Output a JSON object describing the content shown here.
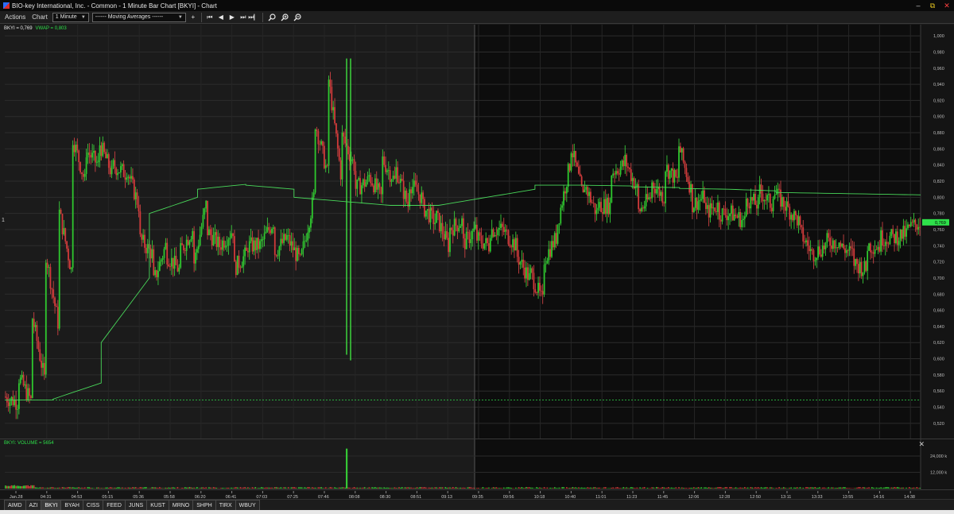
{
  "window": {
    "title": "BIO-key International, Inc. - Common - 1 Minute Bar Chart [BKYI] - Chart",
    "controls": [
      "–",
      "⧉",
      "✕"
    ]
  },
  "toolbar": {
    "actions_label": "Actions",
    "chart_label": "Chart",
    "interval_value": "1 Minute",
    "indicator_value": "------ Moving Averages ------",
    "add_label": "+",
    "nav_labels": [
      "⏮",
      "◀",
      "▶",
      "⏭",
      "⏭▏"
    ]
  },
  "price_pane": {
    "symbol_legend": "BKYI = 0,769",
    "vwap_legend": "VWAP = 0,803",
    "left_marker": "1"
  },
  "volume_pane": {
    "legend": "BKYI: VOLUME = 5654",
    "close_icon": "✕"
  },
  "tabs": [
    {
      "label": "AIMD",
      "active": false
    },
    {
      "label": "AZI",
      "active": false
    },
    {
      "label": "BKYI",
      "active": true
    },
    {
      "label": "BYAH",
      "active": false
    },
    {
      "label": "CISS",
      "active": false
    },
    {
      "label": "FEED",
      "active": false
    },
    {
      "label": "JUNS",
      "active": false
    },
    {
      "label": "KUST",
      "active": false
    },
    {
      "label": "MRNO",
      "active": false
    },
    {
      "label": "SHPH",
      "active": false
    },
    {
      "label": "TIRX",
      "active": false
    },
    {
      "label": "WBUY",
      "active": false
    }
  ],
  "chart_data": {
    "type": "candlestick",
    "symbol": "BKYI",
    "interval": "1 Minute",
    "last_price": "0,769",
    "vwap_value": "0,803",
    "volume_value": "5654",
    "y_ticks": [
      "1,000",
      "0,980",
      "0,960",
      "0,940",
      "0,920",
      "0,900",
      "0,880",
      "0,860",
      "0,840",
      "0,820",
      "0,800",
      "0,780",
      "0,760",
      "0,740",
      "0,720",
      "0,700",
      "0,680",
      "0,660",
      "0,640",
      "0,620",
      "0,600",
      "0,580",
      "0,560",
      "0,540",
      "0,520"
    ],
    "y_values": [
      1.0,
      0.98,
      0.96,
      0.94,
      0.92,
      0.9,
      0.88,
      0.86,
      0.84,
      0.82,
      0.8,
      0.78,
      0.76,
      0.74,
      0.72,
      0.7,
      0.68,
      0.66,
      0.64,
      0.62,
      0.6,
      0.58,
      0.56,
      0.54,
      0.52
    ],
    "ylim": [
      0.51,
      1.008
    ],
    "volume_ticks": [
      "24,000 k",
      "12,000 k"
    ],
    "volume_tick_values": [
      24000,
      12000
    ],
    "volume_max_k": 34000,
    "x_labels": [
      "Jan.28",
      "04:31",
      "04:53",
      "05:15",
      "05:36",
      "05:58",
      "06:20",
      "06:41",
      "07:03",
      "07:25",
      "07:46",
      "08:08",
      "08:30",
      "08:51",
      "09:13",
      "09:35",
      "09:56",
      "10:18",
      "10:40",
      "11:01",
      "11:23",
      "11:45",
      "12:06",
      "12:28",
      "12:50",
      "13:11",
      "13:33",
      "13:55",
      "14:16",
      "14:38"
    ],
    "session_split_label": "09:35",
    "prior_close": 0.549,
    "price_path": [
      [
        0.553,
        0.546
      ],
      [
        0.58,
        0.548
      ],
      [
        0.66,
        0.575
      ],
      [
        0.74,
        0.645
      ],
      [
        0.79,
        0.71
      ],
      [
        0.88,
        0.82
      ],
      [
        0.86,
        0.84
      ],
      [
        0.87,
        0.83
      ],
      [
        0.84,
        0.83
      ],
      [
        0.84,
        0.79
      ],
      [
        0.75,
        0.73
      ],
      [
        0.69,
        0.74
      ],
      [
        0.73,
        0.71
      ],
      [
        0.73,
        0.76
      ],
      [
        0.71,
        0.79
      ],
      [
        0.76,
        0.74
      ],
      [
        0.74,
        0.76
      ],
      [
        0.71,
        0.73
      ],
      [
        0.74,
        0.74
      ],
      [
        0.74,
        0.77
      ],
      [
        0.73,
        0.75
      ],
      [
        0.75,
        0.72
      ],
      [
        0.72,
        0.8
      ],
      [
        0.9,
        0.83
      ],
      [
        0.96,
        0.83
      ],
      [
        0.88,
        0.84
      ],
      [
        0.81,
        0.82
      ],
      [
        0.83,
        0.8
      ],
      [
        0.85,
        0.82
      ],
      [
        0.84,
        0.79
      ],
      [
        0.82,
        0.8
      ],
      [
        0.79,
        0.77
      ],
      [
        0.78,
        0.74
      ],
      [
        0.76,
        0.77
      ],
      [
        0.74,
        0.76
      ],
      [
        0.75,
        0.74
      ],
      [
        0.76,
        0.76
      ],
      [
        0.76,
        0.74
      ],
      [
        0.73,
        0.7
      ],
      [
        0.71,
        0.67
      ],
      [
        0.72,
        0.75
      ],
      [
        0.76,
        0.84
      ],
      [
        0.87,
        0.8
      ],
      [
        0.82,
        0.78
      ],
      [
        0.79,
        0.79
      ],
      [
        0.83,
        0.84
      ],
      [
        0.85,
        0.81
      ],
      [
        0.78,
        0.8
      ],
      [
        0.82,
        0.8
      ],
      [
        0.84,
        0.82
      ],
      [
        0.87,
        0.81
      ],
      [
        0.79,
        0.8
      ],
      [
        0.78,
        0.79
      ],
      [
        0.78,
        0.78
      ],
      [
        0.78,
        0.77
      ],
      [
        0.8,
        0.79
      ],
      [
        0.81,
        0.79
      ],
      [
        0.81,
        0.79
      ],
      [
        0.79,
        0.77
      ],
      [
        0.76,
        0.73
      ],
      [
        0.73,
        0.74
      ],
      [
        0.745,
        0.745
      ],
      [
        0.74,
        0.73
      ],
      [
        0.72,
        0.71
      ],
      [
        0.74,
        0.74
      ],
      [
        0.75,
        0.75
      ],
      [
        0.75,
        0.755
      ],
      [
        0.76,
        0.769
      ]
    ],
    "vwap_path": [
      [
        0.549,
        0.549
      ],
      [
        0.55,
        0.57
      ],
      [
        0.62,
        0.7
      ],
      [
        0.78,
        0.8
      ],
      [
        0.81,
        0.816
      ],
      [
        0.815,
        0.81
      ],
      [
        0.8,
        0.795
      ],
      [
        0.795,
        0.79
      ],
      [
        0.79,
        0.79
      ],
      [
        0.79,
        0.8
      ],
      [
        0.8,
        0.81
      ],
      [
        0.815,
        0.815
      ],
      [
        0.815,
        0.814
      ],
      [
        0.813,
        0.812
      ],
      [
        0.811,
        0.81
      ],
      [
        0.81,
        0.808
      ],
      [
        0.806,
        0.805
      ],
      [
        0.805,
        0.804
      ],
      [
        0.804,
        0.803
      ]
    ]
  }
}
